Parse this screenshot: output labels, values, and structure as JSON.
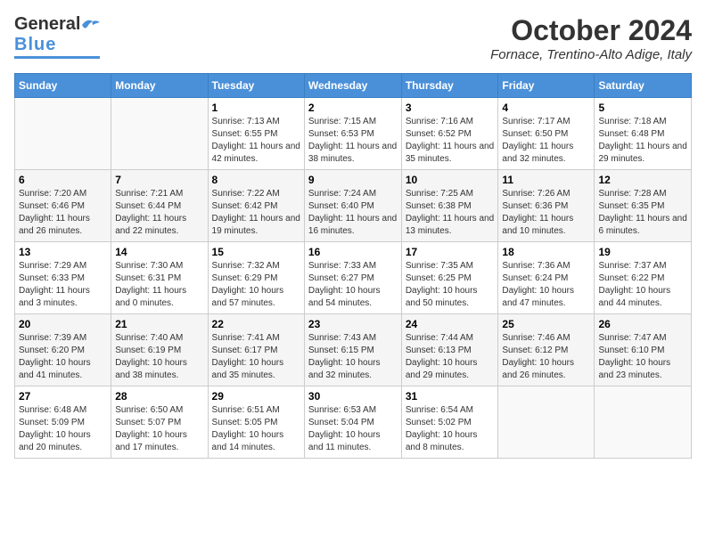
{
  "header": {
    "logo": {
      "line1": "General",
      "line2": "Blue"
    },
    "title": "October 2024",
    "location": "Fornace, Trentino-Alto Adige, Italy"
  },
  "calendar": {
    "columns": [
      "Sunday",
      "Monday",
      "Tuesday",
      "Wednesday",
      "Thursday",
      "Friday",
      "Saturday"
    ],
    "weeks": [
      [
        {
          "day": "",
          "detail": ""
        },
        {
          "day": "",
          "detail": ""
        },
        {
          "day": "1",
          "detail": "Sunrise: 7:13 AM\nSunset: 6:55 PM\nDaylight: 11 hours and 42 minutes."
        },
        {
          "day": "2",
          "detail": "Sunrise: 7:15 AM\nSunset: 6:53 PM\nDaylight: 11 hours and 38 minutes."
        },
        {
          "day": "3",
          "detail": "Sunrise: 7:16 AM\nSunset: 6:52 PM\nDaylight: 11 hours and 35 minutes."
        },
        {
          "day": "4",
          "detail": "Sunrise: 7:17 AM\nSunset: 6:50 PM\nDaylight: 11 hours and 32 minutes."
        },
        {
          "day": "5",
          "detail": "Sunrise: 7:18 AM\nSunset: 6:48 PM\nDaylight: 11 hours and 29 minutes."
        }
      ],
      [
        {
          "day": "6",
          "detail": "Sunrise: 7:20 AM\nSunset: 6:46 PM\nDaylight: 11 hours and 26 minutes."
        },
        {
          "day": "7",
          "detail": "Sunrise: 7:21 AM\nSunset: 6:44 PM\nDaylight: 11 hours and 22 minutes."
        },
        {
          "day": "8",
          "detail": "Sunrise: 7:22 AM\nSunset: 6:42 PM\nDaylight: 11 hours and 19 minutes."
        },
        {
          "day": "9",
          "detail": "Sunrise: 7:24 AM\nSunset: 6:40 PM\nDaylight: 11 hours and 16 minutes."
        },
        {
          "day": "10",
          "detail": "Sunrise: 7:25 AM\nSunset: 6:38 PM\nDaylight: 11 hours and 13 minutes."
        },
        {
          "day": "11",
          "detail": "Sunrise: 7:26 AM\nSunset: 6:36 PM\nDaylight: 11 hours and 10 minutes."
        },
        {
          "day": "12",
          "detail": "Sunrise: 7:28 AM\nSunset: 6:35 PM\nDaylight: 11 hours and 6 minutes."
        }
      ],
      [
        {
          "day": "13",
          "detail": "Sunrise: 7:29 AM\nSunset: 6:33 PM\nDaylight: 11 hours and 3 minutes."
        },
        {
          "day": "14",
          "detail": "Sunrise: 7:30 AM\nSunset: 6:31 PM\nDaylight: 11 hours and 0 minutes."
        },
        {
          "day": "15",
          "detail": "Sunrise: 7:32 AM\nSunset: 6:29 PM\nDaylight: 10 hours and 57 minutes."
        },
        {
          "day": "16",
          "detail": "Sunrise: 7:33 AM\nSunset: 6:27 PM\nDaylight: 10 hours and 54 minutes."
        },
        {
          "day": "17",
          "detail": "Sunrise: 7:35 AM\nSunset: 6:25 PM\nDaylight: 10 hours and 50 minutes."
        },
        {
          "day": "18",
          "detail": "Sunrise: 7:36 AM\nSunset: 6:24 PM\nDaylight: 10 hours and 47 minutes."
        },
        {
          "day": "19",
          "detail": "Sunrise: 7:37 AM\nSunset: 6:22 PM\nDaylight: 10 hours and 44 minutes."
        }
      ],
      [
        {
          "day": "20",
          "detail": "Sunrise: 7:39 AM\nSunset: 6:20 PM\nDaylight: 10 hours and 41 minutes."
        },
        {
          "day": "21",
          "detail": "Sunrise: 7:40 AM\nSunset: 6:19 PM\nDaylight: 10 hours and 38 minutes."
        },
        {
          "day": "22",
          "detail": "Sunrise: 7:41 AM\nSunset: 6:17 PM\nDaylight: 10 hours and 35 minutes."
        },
        {
          "day": "23",
          "detail": "Sunrise: 7:43 AM\nSunset: 6:15 PM\nDaylight: 10 hours and 32 minutes."
        },
        {
          "day": "24",
          "detail": "Sunrise: 7:44 AM\nSunset: 6:13 PM\nDaylight: 10 hours and 29 minutes."
        },
        {
          "day": "25",
          "detail": "Sunrise: 7:46 AM\nSunset: 6:12 PM\nDaylight: 10 hours and 26 minutes."
        },
        {
          "day": "26",
          "detail": "Sunrise: 7:47 AM\nSunset: 6:10 PM\nDaylight: 10 hours and 23 minutes."
        }
      ],
      [
        {
          "day": "27",
          "detail": "Sunrise: 6:48 AM\nSunset: 5:09 PM\nDaylight: 10 hours and 20 minutes."
        },
        {
          "day": "28",
          "detail": "Sunrise: 6:50 AM\nSunset: 5:07 PM\nDaylight: 10 hours and 17 minutes."
        },
        {
          "day": "29",
          "detail": "Sunrise: 6:51 AM\nSunset: 5:05 PM\nDaylight: 10 hours and 14 minutes."
        },
        {
          "day": "30",
          "detail": "Sunrise: 6:53 AM\nSunset: 5:04 PM\nDaylight: 10 hours and 11 minutes."
        },
        {
          "day": "31",
          "detail": "Sunrise: 6:54 AM\nSunset: 5:02 PM\nDaylight: 10 hours and 8 minutes."
        },
        {
          "day": "",
          "detail": ""
        },
        {
          "day": "",
          "detail": ""
        }
      ]
    ]
  }
}
